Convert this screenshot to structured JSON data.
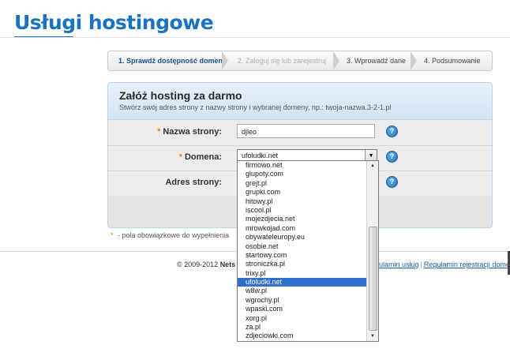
{
  "page": {
    "title": "Usługi hostingowe"
  },
  "steps": [
    {
      "label": "1. Sprawdź dostępność domeny",
      "state": "active"
    },
    {
      "label": "2. Zaloguj się lub zarejestruj",
      "state": "disabled"
    },
    {
      "label": "3. Wprowadź dane",
      "state": "normal"
    },
    {
      "label": "4. Podsumowanie",
      "state": "normal"
    }
  ],
  "form": {
    "title": "Załóż hosting za darmo",
    "subtitle": "Stwórz swój adres strony z nazwy strony i wybranej domeny, np.: twoja-nazwa.3-2-1.pl",
    "required_mark": "*",
    "site_name": {
      "label": "Nazwa strony:",
      "value": "djleo"
    },
    "domain": {
      "label": "Domena:",
      "value": "ufoludki.net"
    },
    "address": {
      "label": "Adres strony:"
    },
    "help_icon": "?"
  },
  "required_note": {
    "mark": "*",
    "text": " - pola obowiązkowe do wypełnienia"
  },
  "footer": {
    "copyright_prefix": "© 2009-2012 ",
    "copyright_brand": "Nets",
    "link_terms": "ulamin usług",
    "link_separator": "|",
    "link_registration": "Regulamin rejestracji domen"
  },
  "domain_options": [
    "firmowo.net",
    "glupoty.com",
    "grejt.pl",
    "grupki.com",
    "hitowy.pl",
    "iscool.pl",
    "mojezdjecia.net",
    "mrowkojad.com",
    "obywateleuropy.eu",
    "osobie.net",
    "startowy.com",
    "stroniczka.pl",
    "trixy.pl",
    "ufoludki.net",
    "w8w.pl",
    "wgrochy.pl",
    "wpaski.com",
    "xorg.pl",
    "za.pl",
    "zdjeciowki.com"
  ],
  "domain_selected": "ufoludki.net",
  "colors": {
    "accent": "#1a73c2",
    "required": "#e8890c",
    "selection": "#3070cc"
  }
}
